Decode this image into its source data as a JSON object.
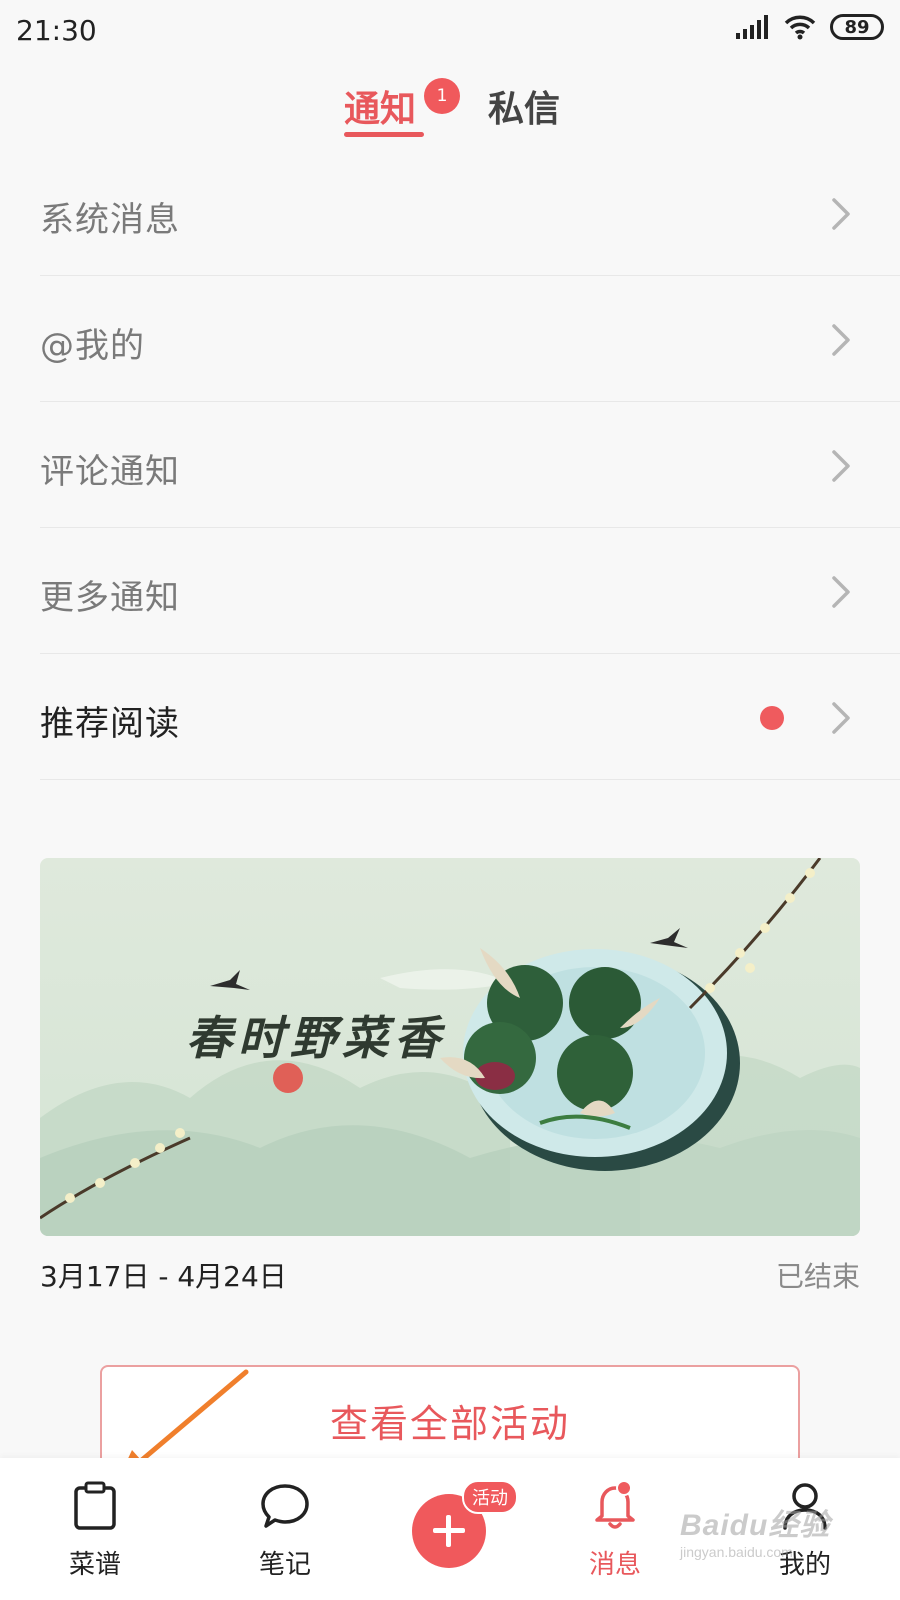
{
  "status_bar": {
    "time": "21:30",
    "battery": "89"
  },
  "tabs": {
    "notify_label": "通知",
    "notify_badge": "1",
    "pm_label": "私信"
  },
  "menu": [
    {
      "label": "系统消息"
    },
    {
      "label": "@我的"
    },
    {
      "label": "评论通知"
    },
    {
      "label": "更多通知"
    },
    {
      "label": "推荐阅读"
    }
  ],
  "event": {
    "banner_title": "春时野菜香",
    "dates": "3月17日 - 4月24日",
    "status": "已结束",
    "view_all_label": "查看全部活动"
  },
  "bottom_nav": {
    "recipe_label": "菜谱",
    "notes_label": "笔记",
    "add_badge": "活动",
    "messages_label": "消息",
    "mine_label": "我的"
  },
  "watermark": {
    "brand": "Baidu经验",
    "url": "jingyan.baidu.com"
  },
  "colors": {
    "accent": "#e8585c",
    "badge": "#f0595c",
    "arrow": "#f07f2c"
  }
}
